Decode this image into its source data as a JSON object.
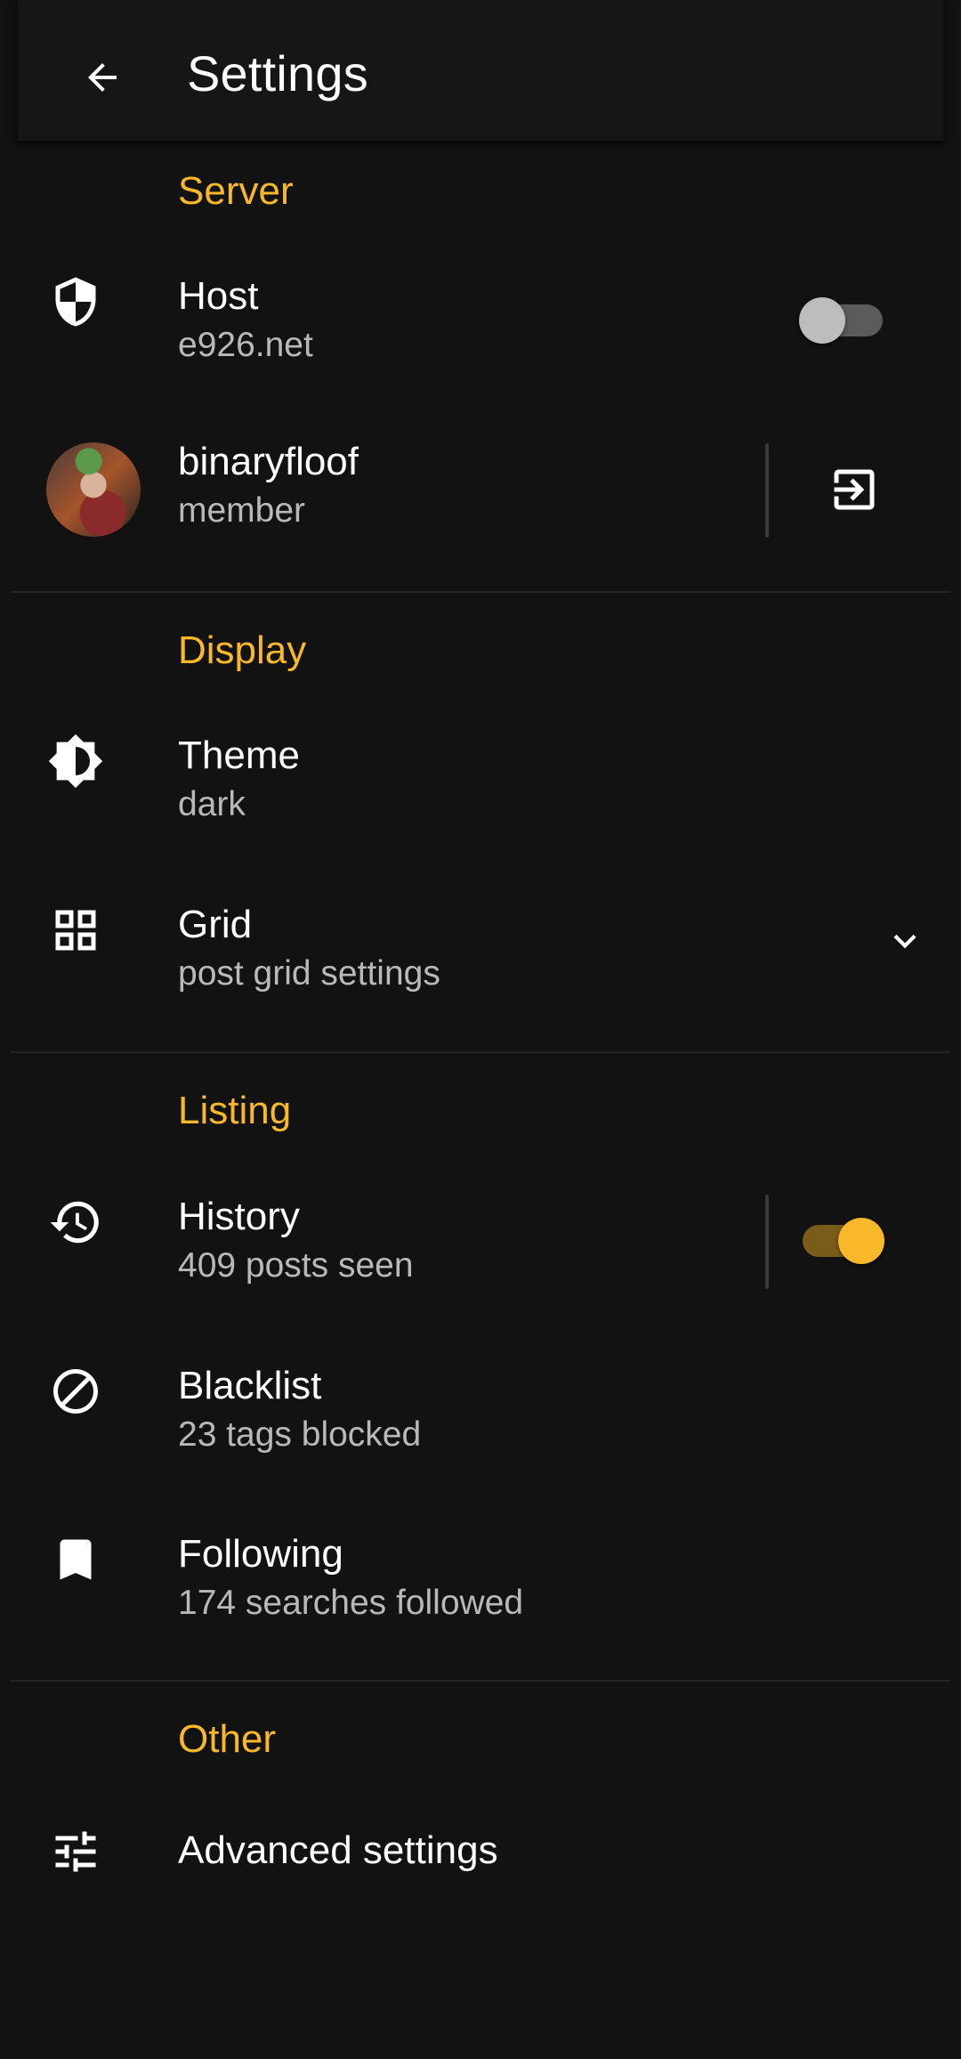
{
  "header": {
    "title": "Settings",
    "back_icon": "arrow-left-icon"
  },
  "sections": {
    "server": {
      "label": "Server",
      "host": {
        "title": "Host",
        "subtitle": "e926.net",
        "toggle_on": false
      },
      "account": {
        "title": "binaryfloof",
        "subtitle": "member",
        "action_icon": "logout-icon"
      }
    },
    "display": {
      "label": "Display",
      "theme": {
        "title": "Theme",
        "subtitle": "dark"
      },
      "grid": {
        "title": "Grid",
        "subtitle": "post grid settings"
      }
    },
    "listing": {
      "label": "Listing",
      "history": {
        "title": "History",
        "subtitle": "409 posts seen",
        "toggle_on": true
      },
      "blacklist": {
        "title": "Blacklist",
        "subtitle": "23 tags blocked"
      },
      "following": {
        "title": "Following",
        "subtitle": "174 searches followed"
      }
    },
    "other": {
      "label": "Other",
      "advanced": {
        "title": "Advanced settings"
      }
    }
  },
  "colors": {
    "accent": "#f8b82a",
    "background": "#121212",
    "subtitle": "#b9b9b9"
  }
}
